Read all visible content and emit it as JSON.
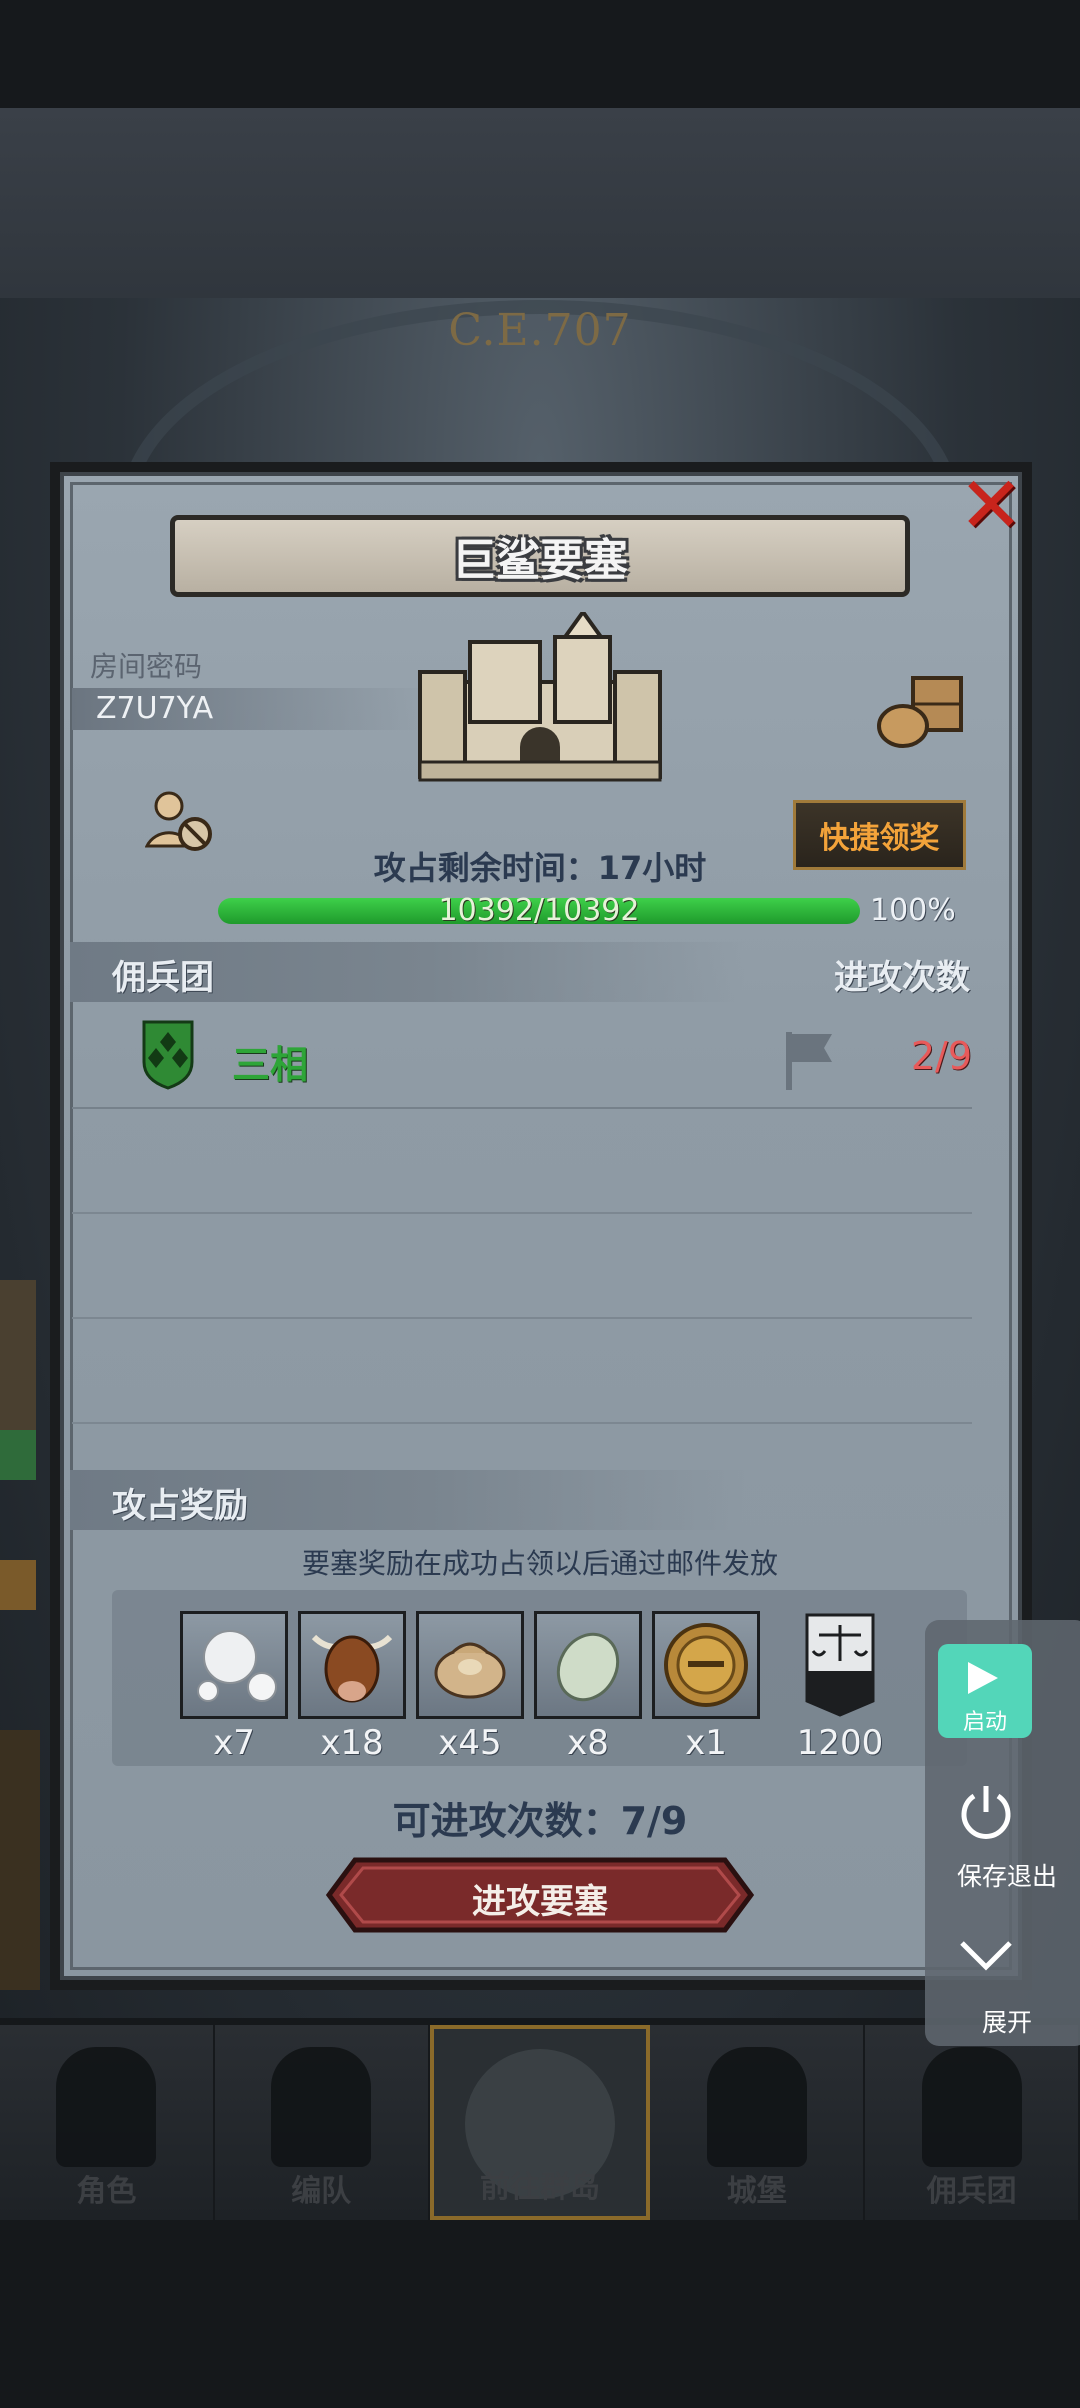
{
  "background": {
    "era": "C.E.707"
  },
  "dialog": {
    "title": "巨鲨要塞",
    "room_label": "房间密码",
    "room_code": "Z7U7YA",
    "quick_claim": "快捷领奖",
    "timer": "攻占剩余时间：17小时",
    "progress": {
      "current": 10392,
      "max": 10392,
      "text": "10392/10392",
      "percent_text": "100%",
      "fraction": 1.0
    }
  },
  "mercenary": {
    "header_left": "佣兵团",
    "header_right": "进攻次数",
    "members": [
      {
        "name": "三相",
        "count": "2/9"
      }
    ]
  },
  "rewards": {
    "header": "攻占奖励",
    "note": "要塞奖励在成功占领以后通过邮件发放",
    "items": [
      {
        "icon": "pearl-icon",
        "qty": "x7"
      },
      {
        "icon": "ox-head-icon",
        "qty": "x18"
      },
      {
        "icon": "sack-icon",
        "qty": "x45"
      },
      {
        "icon": "jade-stone-icon",
        "qty": "x8"
      },
      {
        "icon": "knight-helmet-icon",
        "qty": "x1"
      },
      {
        "icon": "scales-banner-icon",
        "qty": "1200"
      }
    ]
  },
  "attacks": {
    "text": "可进攻次数：7/9",
    "button": "进攻要塞"
  },
  "float_menu": {
    "launch": "启动",
    "save_exit": "保存退出",
    "expand": "展开"
  },
  "bottom_nav": [
    {
      "label": "角色"
    },
    {
      "label": "编队"
    },
    {
      "label": "前往群岛"
    },
    {
      "label": "城堡"
    },
    {
      "label": "佣兵团"
    }
  ],
  "colors": {
    "accent_green": "#2ea538",
    "close_red": "#c8241c",
    "launch_teal": "#53d6b9",
    "claim_orange": "#f3a33a"
  }
}
